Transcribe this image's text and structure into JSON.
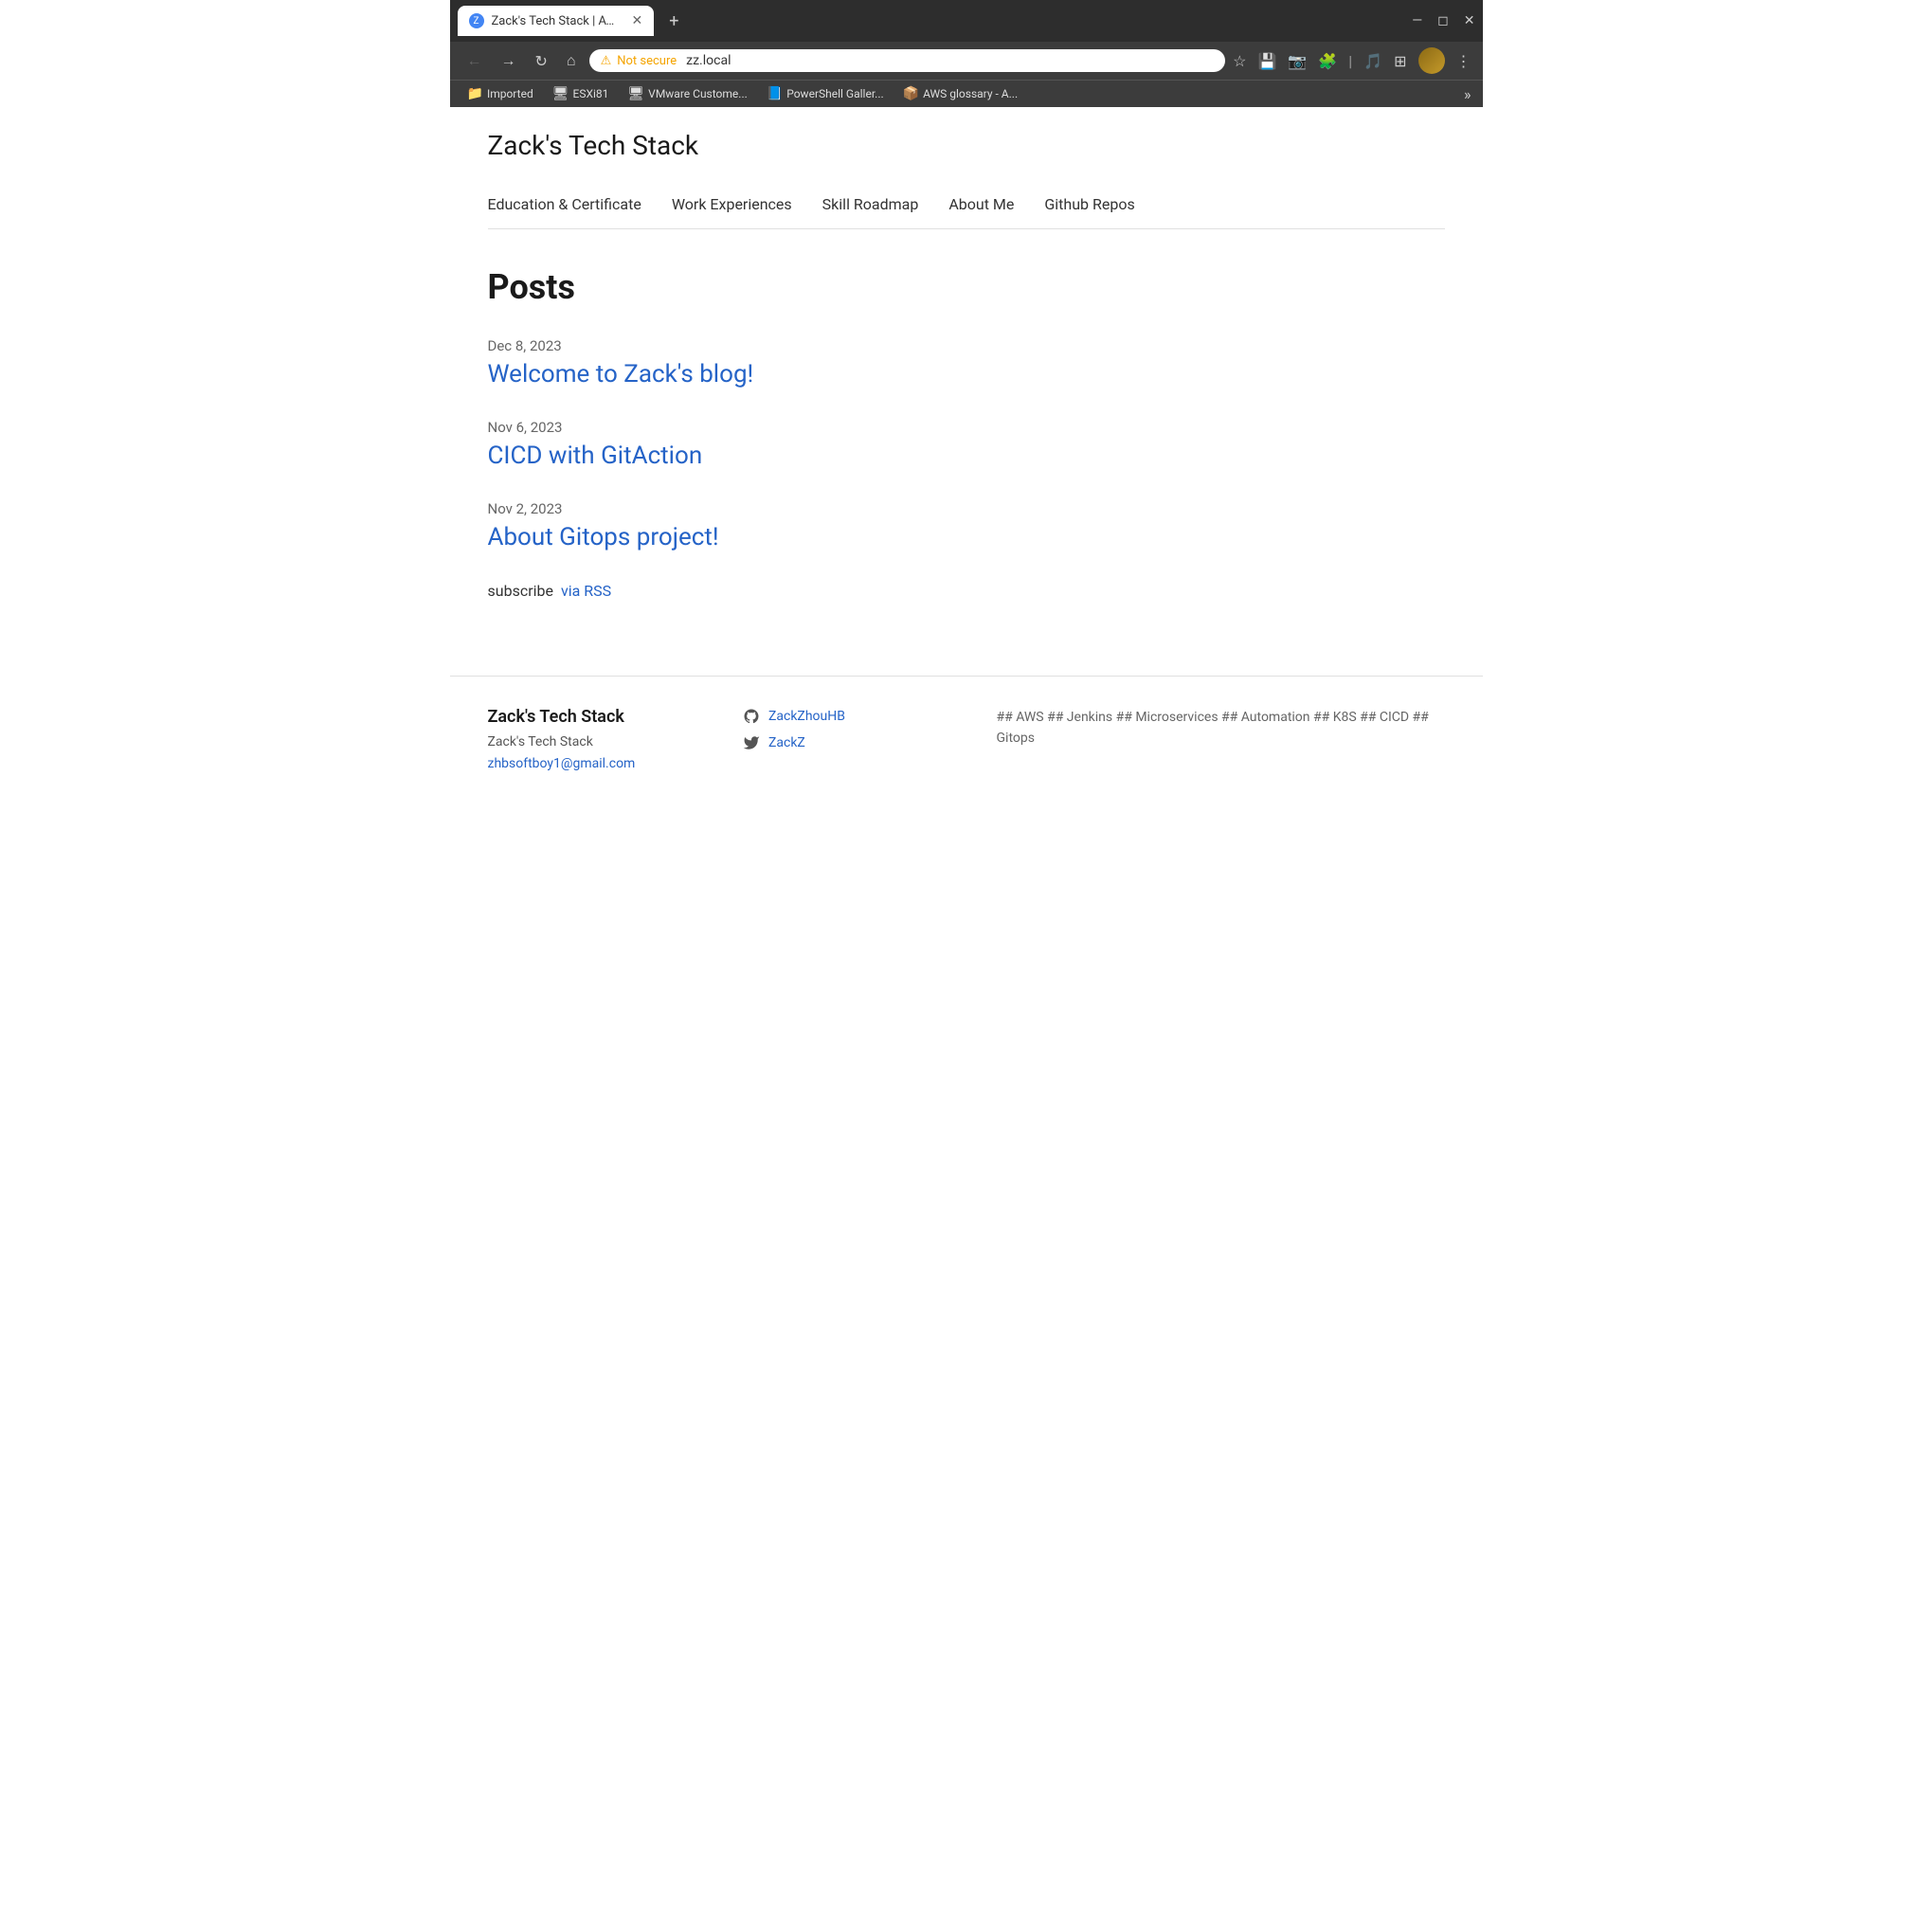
{
  "browser": {
    "tab_title": "Zack's Tech Stack | AWS ## J...",
    "tab_favicon": "Z",
    "close_symbol": "✕",
    "new_tab_symbol": "+",
    "window_minimize": "—",
    "window_restore": "◻",
    "window_close": "✕",
    "back_icon": "←",
    "forward_icon": "→",
    "refresh_icon": "↻",
    "home_icon": "⌂",
    "warning_icon": "⚠",
    "security_label": "Not secure",
    "url": "zz.local",
    "star_icon": "☆",
    "menu_icon": "⋮"
  },
  "bookmarks": {
    "folder_icon": "📁",
    "imported_label": "Imported",
    "items": [
      {
        "label": "ESXi81",
        "icon": "🖥"
      },
      {
        "label": "VMware Custome...",
        "icon": "🖥"
      },
      {
        "label": "PowerShell Galler...",
        "icon": "📘"
      },
      {
        "label": "AWS glossary - A...",
        "icon": "📦"
      }
    ],
    "more_icon": "»"
  },
  "site": {
    "title": "Zack's Tech Stack",
    "nav": {
      "items": [
        {
          "label": "Education & Certificate",
          "href": "#"
        },
        {
          "label": "Work Experiences",
          "href": "#"
        },
        {
          "label": "Skill Roadmap",
          "href": "#"
        },
        {
          "label": "About Me",
          "href": "#"
        },
        {
          "label": "Github Repos",
          "href": "#"
        }
      ]
    },
    "main": {
      "posts_heading": "Posts",
      "posts": [
        {
          "date": "Dec 8, 2023",
          "title": "Welcome to Zack's blog!",
          "href": "#"
        },
        {
          "date": "Nov 6, 2023",
          "title": "CICD with GitAction",
          "href": "#"
        },
        {
          "date": "Nov 2, 2023",
          "title": "About Gitops project!",
          "href": "#"
        }
      ],
      "subscribe_prefix": "subscribe",
      "subscribe_link_label": "via RSS",
      "subscribe_href": "#"
    },
    "footer": {
      "site_title": "Zack's Tech Stack",
      "description": "Zack's Tech Stack",
      "email": "zhbsoftboy1@gmail.com",
      "social": [
        {
          "platform": "github",
          "label": "ZackZhouHB",
          "icon": "github"
        },
        {
          "platform": "twitter",
          "label": "ZackZ",
          "icon": "twitter"
        }
      ],
      "tags": "## AWS ## Jenkins ## Microservices ## Automation ## K8S ## CICD ## Gitops"
    }
  }
}
